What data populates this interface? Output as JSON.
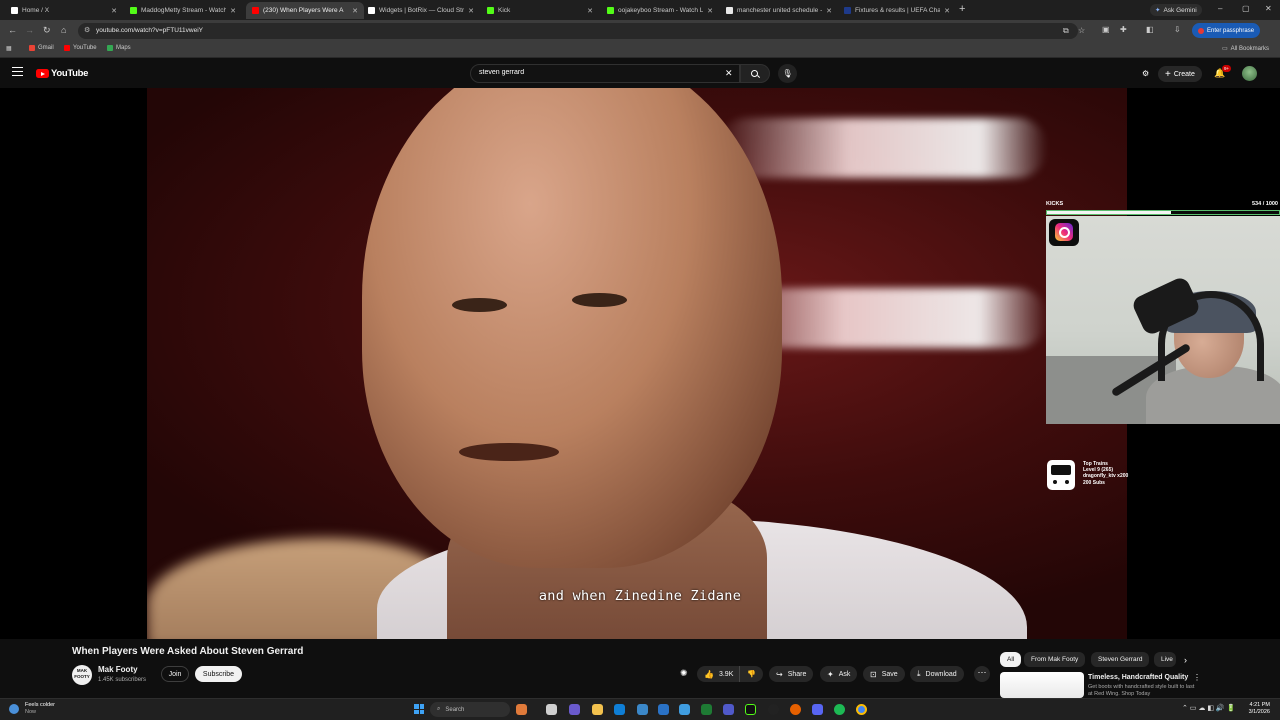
{
  "browser": {
    "tabs": [
      {
        "title": "Home / X",
        "favicon_color": "#ffffff"
      },
      {
        "title": "MaddogMetty Stream - Watch",
        "favicon_color": "#53fc18"
      },
      {
        "title": "(230) When Players Were A",
        "favicon_color": "#ff0000",
        "active": true
      },
      {
        "title": "Widgets | BotRix — Cloud Strea",
        "favicon_color": "#ffffff"
      },
      {
        "title": "Kick",
        "favicon_color": "#53fc18"
      },
      {
        "title": "oojakeyboo Stream - Watch Li",
        "favicon_color": "#53fc18"
      },
      {
        "title": "manchester united schedule - G",
        "favicon_color": "#e8e8e8"
      },
      {
        "title": "Fixtures & results | UEFA Champ",
        "favicon_color": "#1e3a8a"
      }
    ],
    "new_tab": "+",
    "ask_gemini": "Ask Gemini",
    "url": "youtube.com/watch?v=pFTU11vweiY",
    "passphrase_label": "Enter passphrase",
    "bookmarks": [
      {
        "label": "Gmail",
        "color": "#ea4335"
      },
      {
        "label": "YouTube",
        "color": "#ff0000"
      },
      {
        "label": "Maps",
        "color": "#34a853"
      }
    ],
    "all_bookmarks": "All Bookmarks"
  },
  "youtube": {
    "logo_text": "YouTube",
    "search_value": "steven gerrard",
    "create_label": "Create",
    "notifications_badge": "9+"
  },
  "video": {
    "caption": "and when Zinedine Zidane",
    "title": "When Players Were Asked About Steven Gerrard"
  },
  "overlay": {
    "kicks_label": "KICKS",
    "kicks_count": "534 / 1000",
    "kicks_progress": 0.534,
    "top_trains": [
      "Top Trains",
      "Level 9 (265)",
      "dragonfly_ktv x200",
      "200 Subs"
    ]
  },
  "channel": {
    "avatar_text": "MAK FOOTY",
    "name": "Mak Footy",
    "subscribers": "1.45K subscribers",
    "join_label": "Join",
    "subscribe_label": "Subscribe"
  },
  "actions": {
    "like_count": "3.9K",
    "share_label": "Share",
    "ask_label": "Ask",
    "save_label": "Save",
    "download_label": "Download"
  },
  "chips": [
    "All",
    "From Mak Footy",
    "Steven Gerrard",
    "Live"
  ],
  "ad": {
    "title": "Timeless, Handcrafted Quality",
    "description": "Get boots with handcrafted style built to last at Red Wing. Shop Today"
  },
  "taskbar": {
    "weather_line1": "Feels colder",
    "weather_line2": "Now",
    "search_placeholder": "Search",
    "time": "4:21 PM",
    "date": "3/1/2026"
  }
}
